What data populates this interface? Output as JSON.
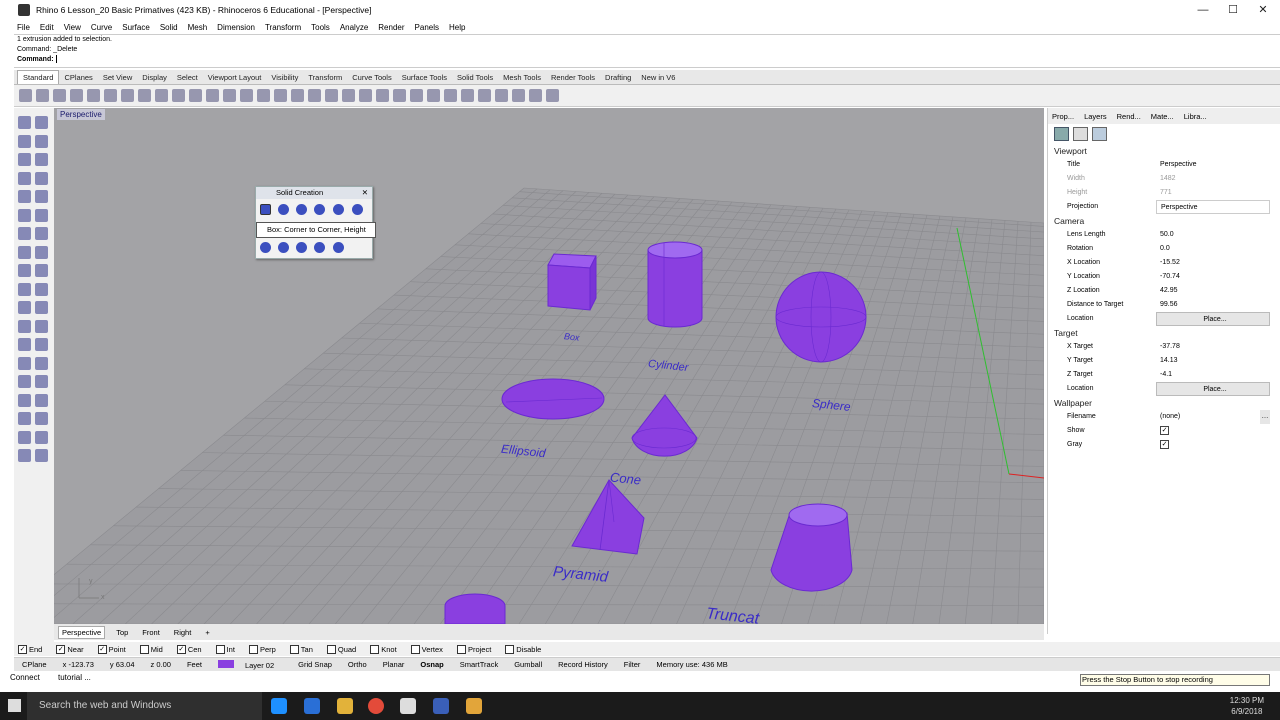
{
  "window": {
    "title": "Rhino 6 Lesson_20 Basic Primatives (423 KB) - Rhinoceros 6 Educational - [Perspective]"
  },
  "menu": [
    "File",
    "Edit",
    "View",
    "Curve",
    "Surface",
    "Solid",
    "Mesh",
    "Dimension",
    "Transform",
    "Tools",
    "Analyze",
    "Render",
    "Panels",
    "Help"
  ],
  "command": {
    "line1": "1 extrusion added to selection.",
    "line2": "Command: _Delete",
    "prompt": "Command:"
  },
  "toolbar_tabs": [
    "Standard",
    "CPlanes",
    "Set View",
    "Display",
    "Select",
    "Viewport Layout",
    "Visibility",
    "Transform",
    "Curve Tools",
    "Surface Tools",
    "Solid Tools",
    "Mesh Tools",
    "Render Tools",
    "Drafting",
    "New in V6"
  ],
  "viewport": {
    "label": "Perspective",
    "objects": [
      "Box",
      "Cylinder",
      "Sphere",
      "Ellipsoid",
      "Cone",
      "Pyramid",
      "Truncat"
    ]
  },
  "solid_panel": {
    "title": "Solid Creation",
    "tooltip": "Box: Corner to Corner, Height"
  },
  "viewport_tabs": [
    "Perspective",
    "Top",
    "Front",
    "Right"
  ],
  "panel_tabs": [
    "Prop...",
    "Layers",
    "Rend...",
    "Mate...",
    "Libra..."
  ],
  "properties": {
    "viewport_header": "Viewport",
    "title_k": "Title",
    "title_v": "Perspective",
    "width_k": "Width",
    "width_v": "1482",
    "height_k": "Height",
    "height_v": "771",
    "projection_k": "Projection",
    "projection_v": "Perspective",
    "camera_header": "Camera",
    "lens_k": "Lens Length",
    "lens_v": "50.0",
    "rotation_k": "Rotation",
    "rotation_v": "0.0",
    "xloc_k": "X Location",
    "xloc_v": "-15.52",
    "yloc_k": "Y Location",
    "yloc_v": "-70.74",
    "zloc_k": "Z Location",
    "zloc_v": "42.95",
    "dist_k": "Distance to Target",
    "dist_v": "99.56",
    "location_k": "Location",
    "place_btn": "Place...",
    "target_header": "Target",
    "xt_k": "X Target",
    "xt_v": "-37.78",
    "yt_k": "Y Target",
    "yt_v": "14.13",
    "zt_k": "Z Target",
    "zt_v": "-4.1",
    "tloc_k": "Location",
    "tplace_btn": "Place...",
    "wallpaper_header": "Wallpaper",
    "file_k": "Filename",
    "file_v": "(none)",
    "show_k": "Show",
    "gray_k": "Gray"
  },
  "osnap": [
    "End",
    "Near",
    "Point",
    "Mid",
    "Cen",
    "Int",
    "Perp",
    "Tan",
    "Quad",
    "Knot",
    "Vertex",
    "Project",
    "Disable"
  ],
  "osnap_checked": [
    true,
    true,
    true,
    false,
    true,
    false,
    false,
    false,
    false,
    false,
    false,
    false,
    false
  ],
  "status": {
    "cplane": "CPlane",
    "x": "x -123.73",
    "y": "y 63.04",
    "z": "z 0.00",
    "units": "Feet",
    "layer": "Layer 02",
    "items": [
      "Grid Snap",
      "Ortho",
      "Planar",
      "Osnap",
      "SmartTrack",
      "Gumball",
      "Record History",
      "Filter"
    ],
    "memory": "Memory use: 436 MB"
  },
  "recbar": {
    "connect": "Connect",
    "tutorial": "tutorial ...",
    "message": "Press the Stop Button to stop recording"
  },
  "taskbar": {
    "search": "Search the web and Windows",
    "time": "12:30 PM",
    "date": "6/9/2018"
  },
  "colors": {
    "object": "#8a3fe0",
    "label": "#3a2cc7",
    "viewport_bg": "#a3a3a6",
    "grid": "#8c8c90"
  }
}
